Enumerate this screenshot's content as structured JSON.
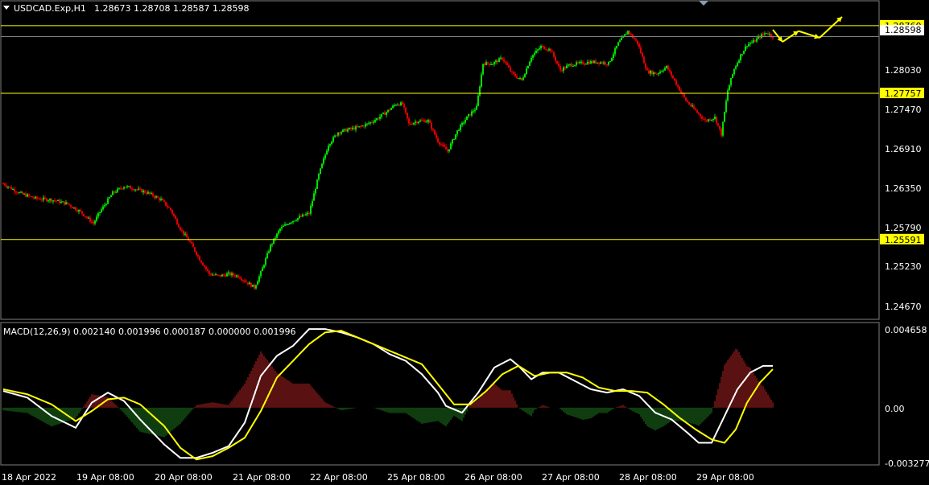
{
  "header": {
    "symbol": "USDCAD.Exp,H1",
    "ohlc": "1.28673 1.28708 1.28587 1.28598"
  },
  "macd": {
    "label": "MACD(12,26,9) 0.002140 0.001996 0.000187 0.000000 0.001996",
    "ticks": [
      "0.004658",
      "0.00",
      "-0.003277"
    ]
  },
  "price_axis": {
    "ticks": [
      "1.28030",
      "1.27470",
      "1.26910",
      "1.26350",
      "1.25790",
      "1.25230",
      "1.24670"
    ],
    "current": "1.28598"
  },
  "levels": [
    {
      "value": 1.2876,
      "label": "1.28760"
    },
    {
      "value": 1.27757,
      "label": "1.27757"
    },
    {
      "value": 1.25591,
      "label": "1.25591"
    }
  ],
  "time_axis": [
    "18 Apr 2022",
    "19 Apr 08:00",
    "20 Apr 08:00",
    "21 Apr 08:00",
    "22 Apr 08:00",
    "25 Apr 08:00",
    "26 Apr 08:00",
    "27 Apr 08:00",
    "28 Apr 08:00",
    "29 Apr 08:00"
  ],
  "colors": {
    "bull": "#00e000",
    "bear": "#e00000",
    "level": "#ffff00",
    "macd_line": "#ffffff",
    "signal_line": "#ffff00",
    "hist_pos": "#b22222",
    "hist_neg": "#1e7a1e",
    "grid": "#808080"
  },
  "chart_data": {
    "type": "candlestick",
    "close_path": [
      [
        0,
        1.2642
      ],
      [
        10,
        1.2628
      ],
      [
        20,
        1.262
      ],
      [
        30,
        1.2618
      ],
      [
        40,
        1.2612
      ],
      [
        48,
        1.26
      ],
      [
        56,
        1.2583
      ],
      [
        60,
        1.26
      ],
      [
        68,
        1.2628
      ],
      [
        75,
        1.2638
      ],
      [
        82,
        1.2634
      ],
      [
        90,
        1.2628
      ],
      [
        98,
        1.2618
      ],
      [
        104,
        1.2603
      ],
      [
        110,
        1.2575
      ],
      [
        116,
        1.2555
      ],
      [
        122,
        1.253
      ],
      [
        128,
        1.2508
      ],
      [
        134,
        1.2505
      ],
      [
        140,
        1.2508
      ],
      [
        146,
        1.2505
      ],
      [
        150,
        1.2498
      ],
      [
        156,
        1.2488
      ],
      [
        160,
        1.251
      ],
      [
        166,
        1.255
      ],
      [
        172,
        1.2575
      ],
      [
        178,
        1.2585
      ],
      [
        184,
        1.2592
      ],
      [
        190,
        1.2598
      ],
      [
        196,
        1.2655
      ],
      [
        202,
        1.27
      ],
      [
        208,
        1.2718
      ],
      [
        214,
        1.2722
      ],
      [
        220,
        1.2725
      ],
      [
        226,
        1.273
      ],
      [
        232,
        1.2738
      ],
      [
        238,
        1.2748
      ],
      [
        244,
        1.276
      ],
      [
        248,
        1.276
      ],
      [
        252,
        1.273
      ],
      [
        258,
        1.2735
      ],
      [
        264,
        1.2735
      ],
      [
        270,
        1.2705
      ],
      [
        276,
        1.269
      ],
      [
        282,
        1.272
      ],
      [
        288,
        1.274
      ],
      [
        294,
        1.2755
      ],
      [
        298,
        1.282
      ],
      [
        304,
        1.282
      ],
      [
        310,
        1.2828
      ],
      [
        316,
        1.2805
      ],
      [
        322,
        1.2795
      ],
      [
        328,
        1.283
      ],
      [
        334,
        1.2845
      ],
      [
        340,
        1.284
      ],
      [
        346,
        1.281
      ],
      [
        352,
        1.2818
      ],
      [
        358,
        1.282
      ],
      [
        364,
        1.2822
      ],
      [
        370,
        1.2822
      ],
      [
        376,
        1.282
      ],
      [
        382,
        1.285
      ],
      [
        388,
        1.2868
      ],
      [
        394,
        1.285
      ],
      [
        400,
        1.2808
      ],
      [
        406,
        1.2805
      ],
      [
        412,
        1.2815
      ],
      [
        418,
        1.279
      ],
      [
        424,
        1.2765
      ],
      [
        430,
        1.275
      ],
      [
        436,
        1.2735
      ],
      [
        442,
        1.274
      ],
      [
        446,
        1.2715
      ],
      [
        450,
        1.278
      ],
      [
        454,
        1.2812
      ],
      [
        458,
        1.2832
      ],
      [
        462,
        1.2848
      ],
      [
        466,
        1.2852
      ],
      [
        470,
        1.286
      ],
      [
        474,
        1.2866
      ],
      [
        478,
        1.286
      ]
    ],
    "price_range": [
      1.2448,
      1.2889
    ],
    "macd_range": [
      -0.003277,
      0.004658
    ],
    "macd": [
      [
        0,
        0.001
      ],
      [
        15,
        0.0006
      ],
      [
        30,
        -0.0005
      ],
      [
        45,
        -0.0012
      ],
      [
        55,
        0.0003
      ],
      [
        65,
        0.0009
      ],
      [
        75,
        0.0004
      ],
      [
        85,
        -0.0007
      ],
      [
        100,
        -0.0022
      ],
      [
        110,
        -0.003
      ],
      [
        120,
        -0.003
      ],
      [
        130,
        -0.0027
      ],
      [
        140,
        -0.0023
      ],
      [
        150,
        -0.0009
      ],
      [
        160,
        0.0019
      ],
      [
        170,
        0.0031
      ],
      [
        180,
        0.0037
      ],
      [
        190,
        0.0047
      ],
      [
        200,
        0.0047
      ],
      [
        210,
        0.0045
      ],
      [
        220,
        0.0042
      ],
      [
        230,
        0.0038
      ],
      [
        240,
        0.0032
      ],
      [
        250,
        0.0028
      ],
      [
        260,
        0.002
      ],
      [
        270,
        0.0009
      ],
      [
        275,
        0.0001
      ],
      [
        285,
        -0.0003
      ],
      [
        295,
        0.0009
      ],
      [
        305,
        0.0024
      ],
      [
        315,
        0.0029
      ],
      [
        320,
        0.0025
      ],
      [
        328,
        0.0017
      ],
      [
        335,
        0.0021
      ],
      [
        345,
        0.0021
      ],
      [
        355,
        0.0016
      ],
      [
        365,
        0.0011
      ],
      [
        375,
        0.0009
      ],
      [
        385,
        0.0011
      ],
      [
        395,
        0.0007
      ],
      [
        405,
        -0.0003
      ],
      [
        415,
        -0.0007
      ],
      [
        425,
        -0.0015
      ],
      [
        432,
        -0.0021
      ],
      [
        440,
        -0.0021
      ],
      [
        448,
        -0.0005
      ],
      [
        456,
        0.0011
      ],
      [
        464,
        0.0021
      ],
      [
        472,
        0.0025
      ],
      [
        478,
        0.0025
      ]
    ],
    "signal": [
      [
        0,
        0.0011
      ],
      [
        15,
        0.0008
      ],
      [
        30,
        0.0002
      ],
      [
        45,
        -0.0008
      ],
      [
        55,
        -0.0002
      ],
      [
        65,
        0.0005
      ],
      [
        75,
        0.0006
      ],
      [
        85,
        0.0002
      ],
      [
        100,
        -0.0011
      ],
      [
        110,
        -0.0024
      ],
      [
        120,
        -0.0031
      ],
      [
        130,
        -0.0029
      ],
      [
        140,
        -0.0024
      ],
      [
        150,
        -0.0018
      ],
      [
        160,
        -0.0002
      ],
      [
        170,
        0.0018
      ],
      [
        180,
        0.0028
      ],
      [
        190,
        0.0038
      ],
      [
        200,
        0.0045
      ],
      [
        210,
        0.0046
      ],
      [
        220,
        0.0042
      ],
      [
        230,
        0.0038
      ],
      [
        240,
        0.0034
      ],
      [
        250,
        0.003
      ],
      [
        260,
        0.0026
      ],
      [
        270,
        0.0014
      ],
      [
        280,
        0.0002
      ],
      [
        290,
        0.0002
      ],
      [
        300,
        0.001
      ],
      [
        310,
        0.002
      ],
      [
        320,
        0.0025
      ],
      [
        330,
        0.0019
      ],
      [
        340,
        0.0021
      ],
      [
        350,
        0.0021
      ],
      [
        360,
        0.0018
      ],
      [
        370,
        0.0012
      ],
      [
        380,
        0.001
      ],
      [
        390,
        0.001
      ],
      [
        400,
        0.0009
      ],
      [
        410,
        0.0002
      ],
      [
        420,
        -0.0006
      ],
      [
        430,
        -0.0013
      ],
      [
        440,
        -0.0019
      ],
      [
        448,
        -0.0021
      ],
      [
        455,
        -0.0013
      ],
      [
        462,
        0.0003
      ],
      [
        470,
        0.0015
      ],
      [
        478,
        0.0023
      ]
    ],
    "forecast_arrows": [
      [
        478,
        1.287
      ],
      [
        484,
        1.2852
      ],
      [
        494,
        1.2868
      ],
      [
        507,
        1.2858
      ],
      [
        521,
        1.2889
      ]
    ]
  }
}
